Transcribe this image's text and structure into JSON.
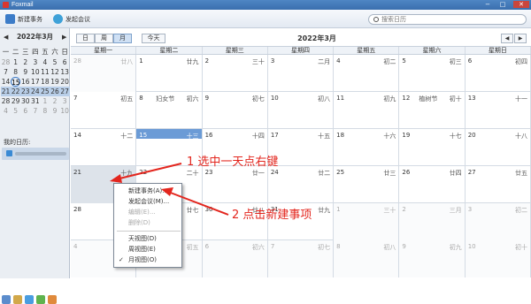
{
  "app": {
    "title": "Foxmail"
  },
  "toolbar": {
    "new_event": "新建事务",
    "start_meeting": "发起会议",
    "search_placeholder": "搜索日历"
  },
  "sidebar": {
    "mini_title": "2022年3月",
    "dow": [
      "一",
      "二",
      "三",
      "四",
      "五",
      "六",
      "日"
    ],
    "rows": [
      [
        "28",
        "1",
        "2",
        "3",
        "4",
        "5",
        "6"
      ],
      [
        "7",
        "8",
        "9",
        "10",
        "11",
        "12",
        "13"
      ],
      [
        "14",
        "15",
        "16",
        "17",
        "18",
        "19",
        "20"
      ],
      [
        "21",
        "22",
        "23",
        "24",
        "25",
        "26",
        "27"
      ],
      [
        "28",
        "29",
        "30",
        "31",
        "1",
        "2",
        "3"
      ],
      [
        "4",
        "5",
        "6",
        "7",
        "8",
        "9",
        "10"
      ]
    ],
    "my_calendars": "我的日历:"
  },
  "views": {
    "day": "日",
    "week": "周",
    "month": "月",
    "today": "今天"
  },
  "month_title": "2022年3月",
  "weekday_headers": [
    "星期一",
    "星期二",
    "星期三",
    "星期四",
    "星期五",
    "星期六",
    "星期日"
  ],
  "weeks": [
    [
      {
        "d": "28",
        "l": "廿八",
        "out": true
      },
      {
        "d": "1",
        "l": "廿九"
      },
      {
        "d": "2",
        "l": "三十"
      },
      {
        "d": "3",
        "l": "二月"
      },
      {
        "d": "4",
        "l": "初二"
      },
      {
        "d": "5",
        "l": "初三"
      },
      {
        "d": "6",
        "l": "初四"
      }
    ],
    [
      {
        "d": "7",
        "l": "初五"
      },
      {
        "d": "8",
        "l": "初六",
        "f": "妇女节"
      },
      {
        "d": "9",
        "l": "初七"
      },
      {
        "d": "10",
        "l": "初八"
      },
      {
        "d": "11",
        "l": "初九"
      },
      {
        "d": "12",
        "l": "初十",
        "f": "植树节"
      },
      {
        "d": "13",
        "l": "十一"
      }
    ],
    [
      {
        "d": "14",
        "l": "十二"
      },
      {
        "d": "15",
        "l": "十三",
        "sel": true
      },
      {
        "d": "16",
        "l": "十四"
      },
      {
        "d": "17",
        "l": "十五"
      },
      {
        "d": "18",
        "l": "十六"
      },
      {
        "d": "19",
        "l": "十七"
      },
      {
        "d": "20",
        "l": "十八"
      }
    ],
    [
      {
        "d": "21",
        "l": "十九",
        "hl": true
      },
      {
        "d": "22",
        "l": "二十"
      },
      {
        "d": "23",
        "l": "廿一"
      },
      {
        "d": "24",
        "l": "廿二"
      },
      {
        "d": "25",
        "l": "廿三"
      },
      {
        "d": "26",
        "l": "廿四"
      },
      {
        "d": "27",
        "l": "廿五"
      }
    ],
    [
      {
        "d": "28",
        "l": "廿六"
      },
      {
        "d": "29",
        "l": "廿七"
      },
      {
        "d": "30",
        "l": "廿八"
      },
      {
        "d": "31",
        "l": "廿九"
      },
      {
        "d": "1",
        "l": "三十",
        "out": true
      },
      {
        "d": "2",
        "l": "三月",
        "out": true
      },
      {
        "d": "3",
        "l": "初二",
        "out": true
      }
    ],
    [
      {
        "d": "4",
        "l": "初四",
        "out": true
      },
      {
        "d": "5",
        "l": "初五",
        "out": true
      },
      {
        "d": "6",
        "l": "初六",
        "out": true
      },
      {
        "d": "7",
        "l": "初七",
        "out": true
      },
      {
        "d": "8",
        "l": "初八",
        "out": true
      },
      {
        "d": "9",
        "l": "初九",
        "out": true
      },
      {
        "d": "10",
        "l": "初十",
        "out": true
      }
    ]
  ],
  "context_menu": {
    "items": [
      "新建事务(A)...",
      "发起会议(M)...",
      "编辑(E)...",
      "删除(D)",
      "天视图(D)",
      "周视图(E)",
      "月视图(O)"
    ]
  },
  "annotations": {
    "step1": "1 选中一天点右键",
    "step2": "2 点击新建事项"
  },
  "colors": {
    "annotation": "#e3261e",
    "accent": "#6b9bd6"
  }
}
